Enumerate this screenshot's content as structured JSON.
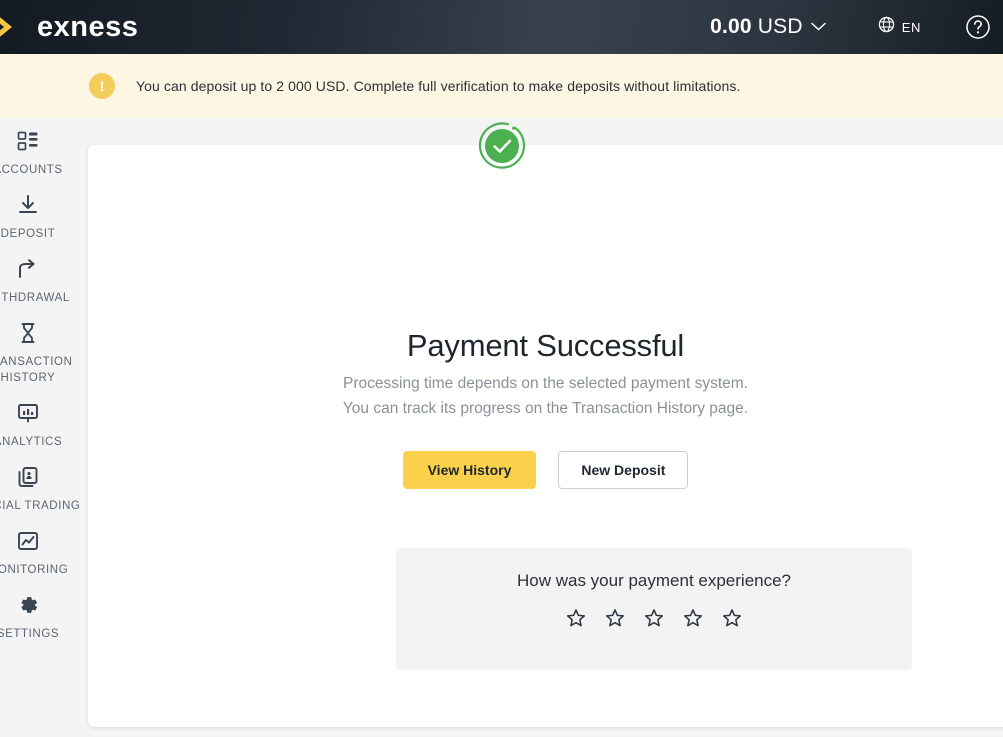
{
  "header": {
    "logo_text": "exness",
    "logo_icon": "exness-x-logo-icon",
    "balance_amount": "0.00",
    "balance_currency": "USD",
    "chevron_icon": "chevron-down-icon",
    "globe_icon": "globe-icon",
    "language": "EN",
    "help_icon": "help-circle-icon",
    "colors": {
      "brand_yellow": "#f5c445",
      "bg_dark": "#1f2832"
    }
  },
  "alert": {
    "icon": "exclamation-icon",
    "icon_glyph": "!",
    "text": "You can deposit up to 2 000 USD. Complete full verification to make deposits without limitations.",
    "bg": "#fdf6e3",
    "icon_bg": "#f5cd5b"
  },
  "sidebar": {
    "items": [
      {
        "label": "ACCOUNTS",
        "icon": "accounts-grid-icon"
      },
      {
        "label": "DEPOSIT",
        "icon": "download-arrow-icon"
      },
      {
        "label": "WITHDRAWAL",
        "icon": "upload-share-arrow-icon"
      },
      {
        "label": "TRANSACTION\nHISTORY",
        "icon": "hourglass-icon"
      },
      {
        "label": "ANALYTICS",
        "icon": "analytics-board-icon"
      },
      {
        "label": "SOCIAL TRADING",
        "icon": "copy-cards-icon"
      },
      {
        "label": "MONITORING",
        "icon": "chart-image-icon"
      },
      {
        "label": "SETTINGS",
        "icon": "gear-icon"
      }
    ]
  },
  "main": {
    "status_icon": "success-check-circle-icon",
    "status_color": "#4caf50",
    "title": "Payment Successful",
    "subtitle_line1": "Processing time depends on the selected payment system.",
    "subtitle_line2": "You can track its progress on the Transaction History page.",
    "buttons": {
      "primary_label": "View History",
      "secondary_label": "New Deposit"
    },
    "rating": {
      "question": "How was your payment experience?",
      "star_icon": "star-outline-icon",
      "star_count": 5,
      "selected": 0,
      "stars": [
        "1",
        "2",
        "3",
        "4",
        "5"
      ]
    }
  }
}
